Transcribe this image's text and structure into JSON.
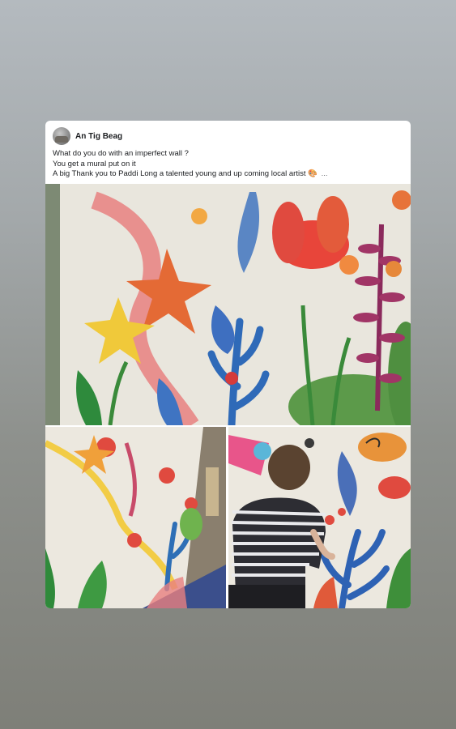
{
  "post": {
    "author": "An Tig Beag",
    "lines": [
      "What do you do with an imperfect wall ?",
      "You get a mural put on it",
      "A big Thank you to Paddi Long a talented  young and up coming local artist 🎨"
    ],
    "more_label": "..."
  },
  "icons": {
    "avatar": "profile-avatar"
  },
  "colors": {
    "card_bg": "#ffffff",
    "text": "#1c1e21",
    "muted": "#65676b"
  }
}
